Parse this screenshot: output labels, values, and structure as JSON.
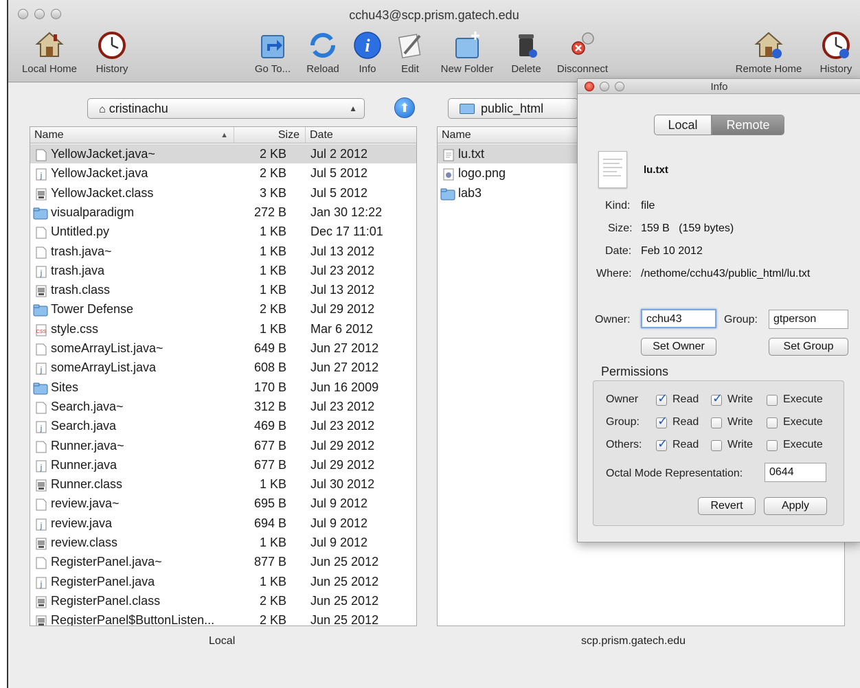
{
  "window": {
    "title": "cchu43@scp.prism.gatech.edu"
  },
  "toolbar": {
    "local_home": "Local Home",
    "history_left": "History",
    "goto": "Go To...",
    "reload": "Reload",
    "info": "Info",
    "edit": "Edit",
    "new_folder": "New Folder",
    "delete": "Delete",
    "disconnect": "Disconnect",
    "remote_home": "Remote Home",
    "history_right": "History"
  },
  "local": {
    "path_selector": "cristinachu",
    "columns": {
      "name": "Name",
      "size": "Size",
      "date": "Date"
    },
    "footer": "Local",
    "files": [
      {
        "name": "YellowJacket.java~",
        "size": "2 KB",
        "date": "Jul 2 2012",
        "kind": "blank"
      },
      {
        "name": "YellowJacket.java",
        "size": "2 KB",
        "date": "Jul 5 2012",
        "kind": "java"
      },
      {
        "name": "YellowJacket.class",
        "size": "3 KB",
        "date": "Jul 5 2012",
        "kind": "class"
      },
      {
        "name": "visualparadigm",
        "size": "272 B",
        "date": "Jan 30 12:22",
        "kind": "folder"
      },
      {
        "name": "Untitled.py",
        "size": "1 KB",
        "date": "Dec 17 11:01",
        "kind": "blank"
      },
      {
        "name": "trash.java~",
        "size": "1 KB",
        "date": "Jul 13 2012",
        "kind": "blank"
      },
      {
        "name": "trash.java",
        "size": "1 KB",
        "date": "Jul 23 2012",
        "kind": "java"
      },
      {
        "name": "trash.class",
        "size": "1 KB",
        "date": "Jul 13 2012",
        "kind": "class"
      },
      {
        "name": "Tower Defense",
        "size": "2 KB",
        "date": "Jul 29 2012",
        "kind": "folder"
      },
      {
        "name": "style.css",
        "size": "1 KB",
        "date": "Mar 6 2012",
        "kind": "css"
      },
      {
        "name": "someArrayList.java~",
        "size": "649 B",
        "date": "Jun 27 2012",
        "kind": "blank"
      },
      {
        "name": "someArrayList.java",
        "size": "608 B",
        "date": "Jun 27 2012",
        "kind": "java"
      },
      {
        "name": "Sites",
        "size": "170 B",
        "date": "Jun 16 2009",
        "kind": "folder"
      },
      {
        "name": "Search.java~",
        "size": "312 B",
        "date": "Jul 23 2012",
        "kind": "blank"
      },
      {
        "name": "Search.java",
        "size": "469 B",
        "date": "Jul 23 2012",
        "kind": "java"
      },
      {
        "name": "Runner.java~",
        "size": "677 B",
        "date": "Jul 29 2012",
        "kind": "blank"
      },
      {
        "name": "Runner.java",
        "size": "677 B",
        "date": "Jul 29 2012",
        "kind": "java"
      },
      {
        "name": "Runner.class",
        "size": "1 KB",
        "date": "Jul 30 2012",
        "kind": "class"
      },
      {
        "name": "review.java~",
        "size": "695 B",
        "date": "Jul 9 2012",
        "kind": "blank"
      },
      {
        "name": "review.java",
        "size": "694 B",
        "date": "Jul 9 2012",
        "kind": "java"
      },
      {
        "name": "review.class",
        "size": "1 KB",
        "date": "Jul 9 2012",
        "kind": "class"
      },
      {
        "name": "RegisterPanel.java~",
        "size": "877 B",
        "date": "Jun 25 2012",
        "kind": "blank"
      },
      {
        "name": "RegisterPanel.java",
        "size": "1 KB",
        "date": "Jun 25 2012",
        "kind": "java"
      },
      {
        "name": "RegisterPanel.class",
        "size": "2 KB",
        "date": "Jun 25 2012",
        "kind": "class"
      },
      {
        "name": "RegisterPanel$ButtonListen...",
        "size": "2 KB",
        "date": "Jun 25 2012",
        "kind": "class"
      }
    ]
  },
  "remote": {
    "path_selector": "public_html",
    "columns": {
      "name": "Name"
    },
    "footer": "scp.prism.gatech.edu",
    "files": [
      {
        "name": "lu.txt",
        "kind": "text"
      },
      {
        "name": "logo.png",
        "kind": "image"
      },
      {
        "name": "lab3",
        "kind": "folder"
      }
    ]
  },
  "info_panel": {
    "title": "Info",
    "tab_local": "Local",
    "tab_remote": "Remote",
    "file_name": "lu.txt",
    "kind_label": "Kind:",
    "kind_value": "file",
    "size_label": "Size:",
    "size_value": "159 B   (159 bytes)",
    "date_label": "Date:",
    "date_value": "Feb 10 2012",
    "where_label": "Where:",
    "where_value": "/nethome/cchu43/public_html/lu.txt",
    "owner_label": "Owner:",
    "owner_value": "cchu43",
    "group_label": "Group:",
    "group_value": "gtperson",
    "set_owner": "Set Owner",
    "set_group": "Set Group",
    "permissions_title": "Permissions",
    "perm_rows": [
      {
        "label": "Owner",
        "read": true,
        "write": true,
        "execute": false
      },
      {
        "label": "Group:",
        "read": true,
        "write": false,
        "execute": false
      },
      {
        "label": "Others:",
        "read": true,
        "write": false,
        "execute": false
      }
    ],
    "read_label": "Read",
    "write_label": "Write",
    "execute_label": "Execute",
    "octal_label": "Octal Mode Representation:",
    "octal_value": "0644",
    "revert": "Revert",
    "apply": "Apply"
  }
}
